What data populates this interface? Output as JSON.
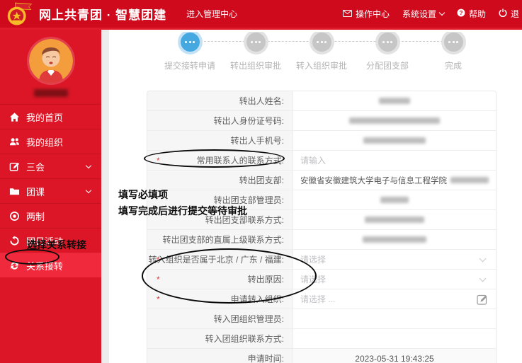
{
  "header": {
    "title": "网上共青团 · 智慧团建",
    "enter_admin": "进入管理中心",
    "nav": [
      {
        "label": "操作中心",
        "icon": "envelope-icon"
      },
      {
        "label": "系统设置",
        "icon": "chevron-down-icon"
      },
      {
        "label": "帮助",
        "icon": "question-circle-icon"
      },
      {
        "label": "退",
        "icon": "power-icon"
      }
    ],
    "colors": {
      "header_red": "#cf0a1d",
      "sidebar_red": "#dc1626",
      "active_item_red": "#f1293c"
    }
  },
  "sidebar": {
    "items": [
      {
        "label": "我的首页",
        "icon": "home-icon",
        "expandable": false,
        "active": false
      },
      {
        "label": "我的组织",
        "icon": "users-icon",
        "expandable": false,
        "active": false
      },
      {
        "label": "三会",
        "icon": "edit-icon",
        "expandable": true,
        "active": false
      },
      {
        "label": "团课",
        "icon": "folder-icon",
        "expandable": true,
        "active": false
      },
      {
        "label": "两制",
        "icon": "target-icon",
        "expandable": false,
        "active": false
      },
      {
        "label": "团日活动",
        "icon": "activity-icon",
        "expandable": false,
        "active": false
      },
      {
        "label": "关系接转",
        "icon": "transfer-icon",
        "expandable": false,
        "active": true
      }
    ]
  },
  "stepper": {
    "active_index": 0,
    "active_color": "#45a8e1",
    "inactive_color": "#c6c6c6",
    "steps": [
      {
        "label": "提交接转申请"
      },
      {
        "label": "转出组织审批"
      },
      {
        "label": "转入组织审批"
      },
      {
        "label": "分配团支部"
      },
      {
        "label": "完成"
      }
    ]
  },
  "form": {
    "rows": [
      {
        "label": "转出人姓名:",
        "required": false,
        "type": "redacted"
      },
      {
        "label": "转出人身份证号码:",
        "required": false,
        "type": "redacted"
      },
      {
        "label": "转出人手机号:",
        "required": false,
        "type": "redacted"
      },
      {
        "label": "常用联系人的联系方式:",
        "required": true,
        "type": "input",
        "placeholder": "请输入"
      },
      {
        "label": "转出团支部:",
        "required": false,
        "type": "text-redacted",
        "value": "安徽省安徽建筑大学电子与信息工程学院"
      },
      {
        "label": "转出团支部管理员:",
        "required": false,
        "type": "redacted"
      },
      {
        "label": "转出团支部联系方式:",
        "required": false,
        "type": "redacted"
      },
      {
        "label": "转出团支部的直属上级联系方式:",
        "required": false,
        "type": "redacted"
      },
      {
        "label": "转入组织是否属于北京 / 广东 / 福建:",
        "required": true,
        "type": "select",
        "placeholder": "请选择"
      },
      {
        "label": "转出原因:",
        "required": true,
        "type": "select",
        "placeholder": "请选择"
      },
      {
        "label": "申请转入组织:",
        "required": true,
        "type": "picker",
        "placeholder": "请选择 ..."
      },
      {
        "label": "转入团组织管理员:",
        "required": false,
        "type": "empty"
      },
      {
        "label": "转入团组织联系方式:",
        "required": false,
        "type": "empty"
      },
      {
        "label": "申请时间:",
        "required": false,
        "type": "text",
        "value": "2023-05-31 19:43:25"
      }
    ]
  },
  "annotations": {
    "notes": [
      {
        "text": "填写必填项"
      },
      {
        "text": "填写完成后进行提交等待审批"
      },
      {
        "text": "选择关系转接"
      }
    ]
  },
  "ui": {
    "required_marker": "*"
  }
}
